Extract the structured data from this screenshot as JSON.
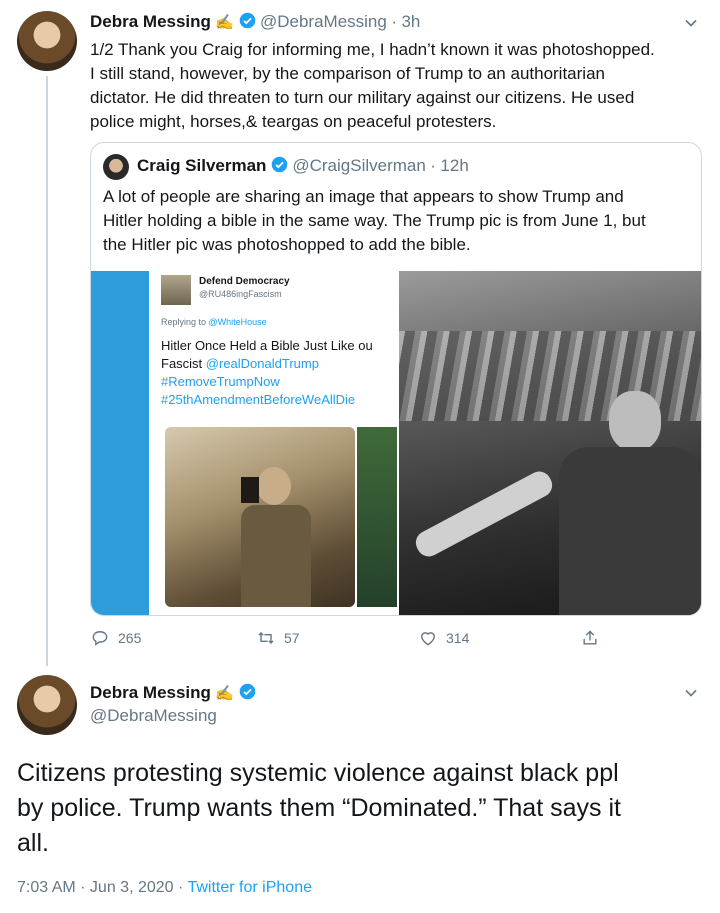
{
  "tweet1": {
    "name": "Debra Messing",
    "handle": "@DebraMessing",
    "time": "3h",
    "text_lines": [
      "1/2 Thank you Craig for informing me, I hadn’t known it was photoshopped.",
      "I still stand, however, by the comparison of Trump to an authoritarian",
      "dictator. He did threaten to turn our military against our citizens. He used",
      "police might, horses,& teargas on peaceful protesters."
    ],
    "quoted": {
      "name": "Craig Silverman",
      "handle": "@CraigSilverman",
      "time": "12h",
      "text_lines": [
        "A lot of people are sharing an image that appears to show Trump and",
        "Hitler holding a bible in the same way. The Trump pic is from June 1, but",
        "the Hitler pic was photoshopped to add the bible."
      ],
      "embedded": {
        "account_name": "Defend Democracy",
        "account_handle": "@RU486ingFascism",
        "replying_to_prefix": "Replying to ",
        "replying_to": "@WhiteHouse",
        "line1": "Hitler Once Held a Bible Just Like ou",
        "line2_prefix": "Fascist ",
        "line2_link": "@realDonaldTrump",
        "hashtag1": "#RemoveTrumpNow",
        "hashtag2": "#25thAmendmentBeforeWeAllDie"
      }
    },
    "actions": {
      "replies": "265",
      "retweets": "57",
      "likes": "314"
    }
  },
  "tweet2": {
    "name": "Debra Messing",
    "handle": "@DebraMessing",
    "text_lines": [
      "Citizens protesting systemic violence against black ppl",
      "by police. Trump wants them “Dominated.” That says it",
      "all."
    ],
    "timestamp": "7:03 AM · Jun 3, 2020 · ",
    "source": "Twitter for iPhone"
  },
  "colors": {
    "verified": "#1da1f2",
    "link": "#1da1f2",
    "secondary_text": "#657786",
    "border": "#ccd6dd"
  },
  "icons": {
    "reply": "reply-icon",
    "retweet": "retweet-icon",
    "like": "heart-icon",
    "share": "share-icon",
    "verified": "verified-badge-icon",
    "more": "chevron-down-icon"
  }
}
